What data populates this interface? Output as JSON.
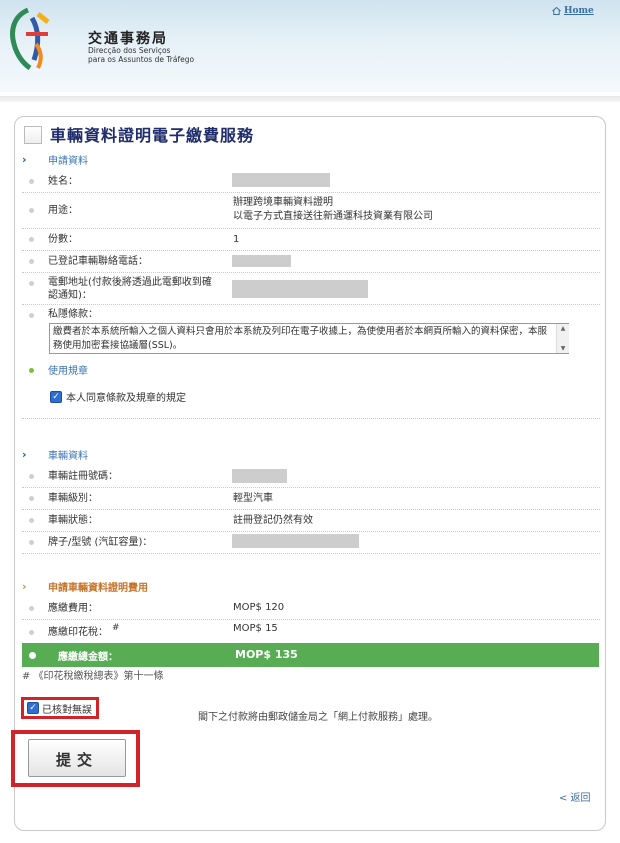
{
  "header": {
    "org_cn": "交通事務局",
    "org_pt_line1": "Direcção dos Serviços",
    "org_pt_line2": "para os Assuntos de Tráfego",
    "home_link": "Home"
  },
  "page": {
    "title": "車輛資料證明電子繳費服務"
  },
  "application": {
    "section_title": "申請資料",
    "fields": [
      {
        "label": "姓名：",
        "value": ""
      },
      {
        "label": "用途：",
        "value_line1": "辦理跨境車輛資料證明",
        "value_line2": "以電子方式直接送往新通運科技資業有限公司"
      },
      {
        "label": "份數：",
        "value": "1"
      },
      {
        "label": "已登記車輛聯絡電話：",
        "value": ""
      },
      {
        "label_line1": "電郵地址(付款後將透過此電郵收到確",
        "label_line2": "認通知)：",
        "value": ""
      }
    ],
    "privacy_label": "私隱條款：",
    "privacy_text": "繳費者於本系統所輸入之個人資料只會用於本系統及列印在電子收據上，為使使用者於本網頁所輸入的資料保密，本服務使用加密套接協議層(SSL)。",
    "rules_link": "使用規章",
    "agree_label": "本人同意條款及規章的規定",
    "agree_checked": true
  },
  "vehicle": {
    "section_title": "車輛資料",
    "fields": [
      {
        "label": "車輛註冊號碼：",
        "value": ""
      },
      {
        "label": "車輛級別：",
        "value": "輕型汽車"
      },
      {
        "label": "車輛狀態：",
        "value": "註冊登記仍然有效"
      },
      {
        "label": "牌子/型號 (汽缸容量)：",
        "value": ""
      }
    ]
  },
  "fees": {
    "section_title": "申請車輛資料證明費用",
    "rows": [
      {
        "label": "應繳費用：",
        "value": "MOP$ 120"
      },
      {
        "label": "應繳印花稅：",
        "mark": "#",
        "value": "MOP$ 15"
      }
    ],
    "total_label": "應繳總金額：",
    "total_value": "MOP$ 135",
    "footnote": "# 《印花稅繳稅總表》第十一條"
  },
  "confirm": {
    "verify_label": "已核對無誤",
    "verify_checked": true,
    "notice": "閣下之付款將由郵政儲金局之「網上付款服務」處理。",
    "submit_label": "提交",
    "back_link": "< 返回"
  },
  "colors": {
    "total_bar": "#57ac54",
    "highlight_border": "#d3232a",
    "title_text": "#1f2d6b"
  }
}
